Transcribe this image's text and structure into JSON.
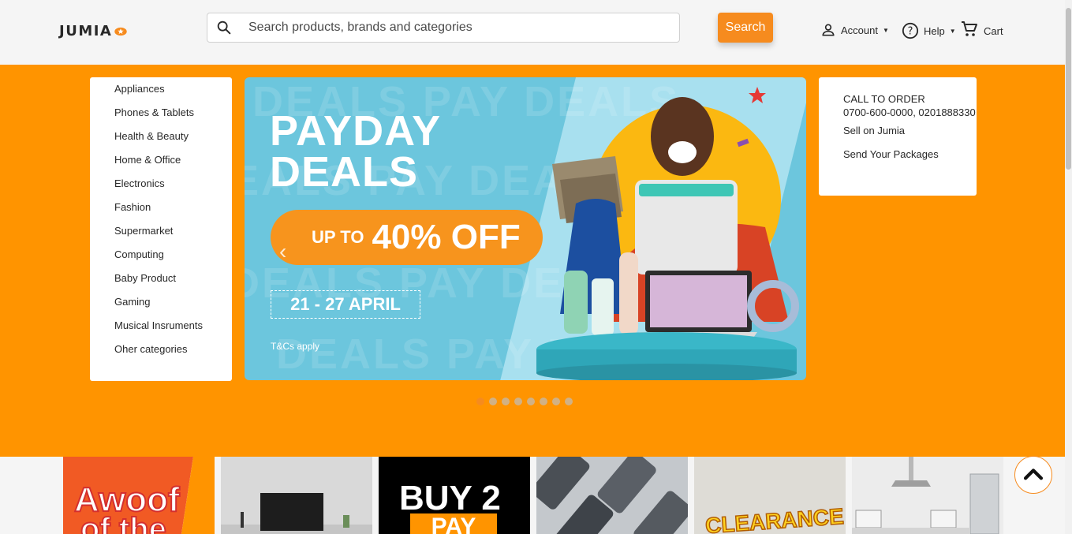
{
  "header": {
    "logo_text": "JUMIA",
    "search_placeholder": "Search products, brands and categories",
    "search_button": "Search",
    "account_label": "Account",
    "help_label": "Help",
    "cart_label": "Cart"
  },
  "categories": [
    "Appliances",
    "Phones & Tablets",
    "Health & Beauty",
    "Home & Office",
    "Electronics",
    "Fashion",
    "Supermarket",
    "Computing",
    "Baby Product",
    "Gaming",
    "Musical Insruments",
    "Oher categories"
  ],
  "banner": {
    "bg_text": "DEALS PAY DEALS",
    "title_line1": "PAYDAY",
    "title_line2": "DEALS",
    "up_to": "UP TO",
    "discount": "40% OFF",
    "dates": "21 - 27 APRIL",
    "terms": "T&Cs apply",
    "prev_arrow": "‹"
  },
  "carousel": {
    "slides": 8,
    "active": 1
  },
  "info": {
    "call_label": "CALL TO ORDER",
    "phones": "0700-600-0000, 0201888330",
    "sell": "Sell on Jumia",
    "send": "Send Your Packages"
  },
  "tiles": [
    {
      "name": "awoof",
      "label": "Awoof",
      "label2": "of the"
    },
    {
      "name": "tv"
    },
    {
      "name": "buy2",
      "label": "BUY 2",
      "label2": "PAY"
    },
    {
      "name": "phones"
    },
    {
      "name": "clearance",
      "label": "CLEARANCE"
    },
    {
      "name": "kitchen"
    }
  ],
  "colors": {
    "brand_orange": "#f68b1e",
    "hero_orange": "#ff9400",
    "banner_blue": "#6cc6dd"
  }
}
